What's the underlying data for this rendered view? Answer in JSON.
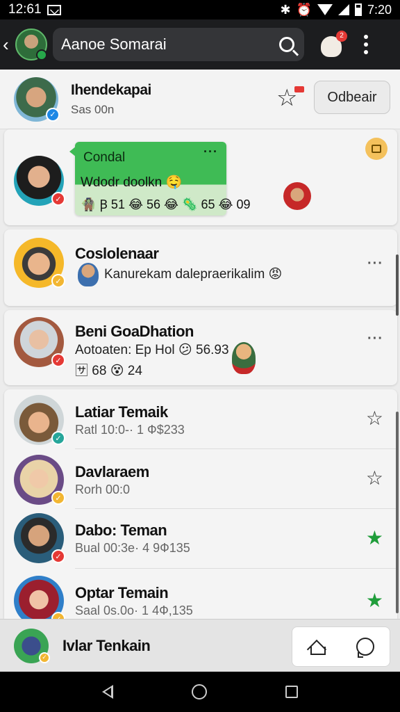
{
  "status_bar": {
    "time": "12:61",
    "clock": "7:20"
  },
  "top_bar": {
    "search_value": "Aanoe Somarai",
    "notification_count": "2"
  },
  "profile": {
    "name": "Ihendekapai",
    "subtitle": "Sas 00n",
    "button_label": "Odbeair"
  },
  "message_card": {
    "title": "Condal",
    "menu": "···",
    "line": "Wdodr doolkn 🤤",
    "stats": "🧌 Ꞵ 51 😂 56 😂 🦠 65 😂 09"
  },
  "chats": [
    {
      "name": "Coslolenaar",
      "preview": "Kanurekam dalepraerikalim 😡",
      "more": "···"
    },
    {
      "name": "Beni GoaDhation",
      "preview": "Aotoaten: Ep Hol 😕 56.93",
      "meta": "🈂 68 😵 24",
      "more": "···"
    }
  ],
  "list": [
    {
      "name": "Latiar Temaik",
      "sub": "Ratl 10:0-· 1 Ф$233",
      "starred": false
    },
    {
      "name": "Davlaraem",
      "sub": "Rorh 00:0",
      "starred": false
    },
    {
      "name": "Dabo: Teman",
      "sub": "Bual 00:3e· 4 9Ф135",
      "starred": true
    },
    {
      "name": "Optar Temain",
      "sub": "Saal 0s.0o· 1 4Ф,135",
      "starred": true
    }
  ],
  "bottom_bar": {
    "name": "Ivlar Tenkain"
  },
  "colors": {
    "accent_green": "#3fbb55",
    "star_green": "#1f9d3a",
    "badge_red": "#e53935"
  }
}
